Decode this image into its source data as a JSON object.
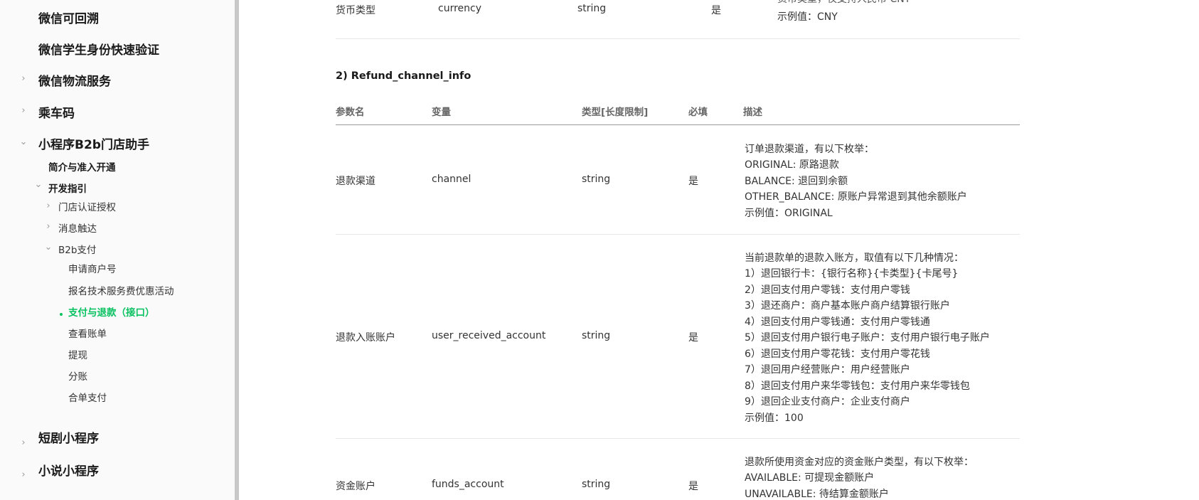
{
  "sidebar": {
    "items": [
      {
        "label": "微信可回溯"
      },
      {
        "label": "微信学生身份快速验证"
      },
      {
        "label": "微信物流服务"
      },
      {
        "label": "乘车码"
      },
      {
        "label": "小程序B2b门店助手"
      },
      {
        "label": "简介与准入开通"
      },
      {
        "label": "开发指引"
      },
      {
        "label": "门店认证授权"
      },
      {
        "label": "消息触达"
      },
      {
        "label": "B2b支付"
      },
      {
        "label": "申请商户号"
      },
      {
        "label": "报名技术服务费优惠活动"
      },
      {
        "label": "支付与退款（接口）"
      },
      {
        "label": "查看账单"
      },
      {
        "label": "提现"
      },
      {
        "label": "分账"
      },
      {
        "label": "合单支付"
      },
      {
        "label": "短剧小程序"
      },
      {
        "label": "小说小程序"
      }
    ]
  },
  "prev_row": {
    "name": "货币类型",
    "variable": "currency",
    "type": "string",
    "required": "是",
    "desc_partial": "货币类型，仅支持人民币 CNY",
    "example": "示例值：CNY"
  },
  "section": {
    "title": "2) Refund_channel_info"
  },
  "table": {
    "headers": [
      "参数名",
      "变量",
      "类型[长度限制]",
      "必填",
      "描述"
    ],
    "rows": [
      {
        "name": "退款渠道",
        "variable": "channel",
        "type": "string",
        "required": "是",
        "desc": [
          "订单退款渠道，有以下枚举：",
          "ORIGINAL: 原路退款",
          "BALANCE: 退回到余额",
          "OTHER_BALANCE: 原账户异常退到其他余额账户"
        ],
        "example": "示例值：ORIGINAL"
      },
      {
        "name": "退款入账账户",
        "variable": "user_received_account",
        "type": "string",
        "required": "是",
        "desc": [
          "当前退款单的退款入账方，取值有以下几种情况：",
          "1）退回银行卡：{银行名称}{卡类型}{卡尾号}",
          "2）退回支付用户零钱：支付用户零钱",
          "3）退还商户：商户基本账户商户结算银行账户",
          "4）退回支付用户零钱通：支付用户零钱通",
          "5）退回支付用户银行电子账户：支付用户银行电子账户",
          "6）退回支付用户零花钱：支付用户零花钱",
          "7）退回用户经营账户：用户经营账户",
          "8）退回支付用户来华零钱包：支付用户来华零钱包",
          "9）退回企业支付商户：企业支付商户"
        ],
        "example": "示例值：100"
      },
      {
        "name": "资金账户",
        "variable": "funds_account",
        "type": "string",
        "required": "是",
        "desc": [
          "退款所使用资金对应的资金账户类型，有以下枚举：",
          "AVAILABLE: 可提现金额账户",
          "UNAVAILABLE: 待结算金额账户"
        ]
      }
    ]
  }
}
